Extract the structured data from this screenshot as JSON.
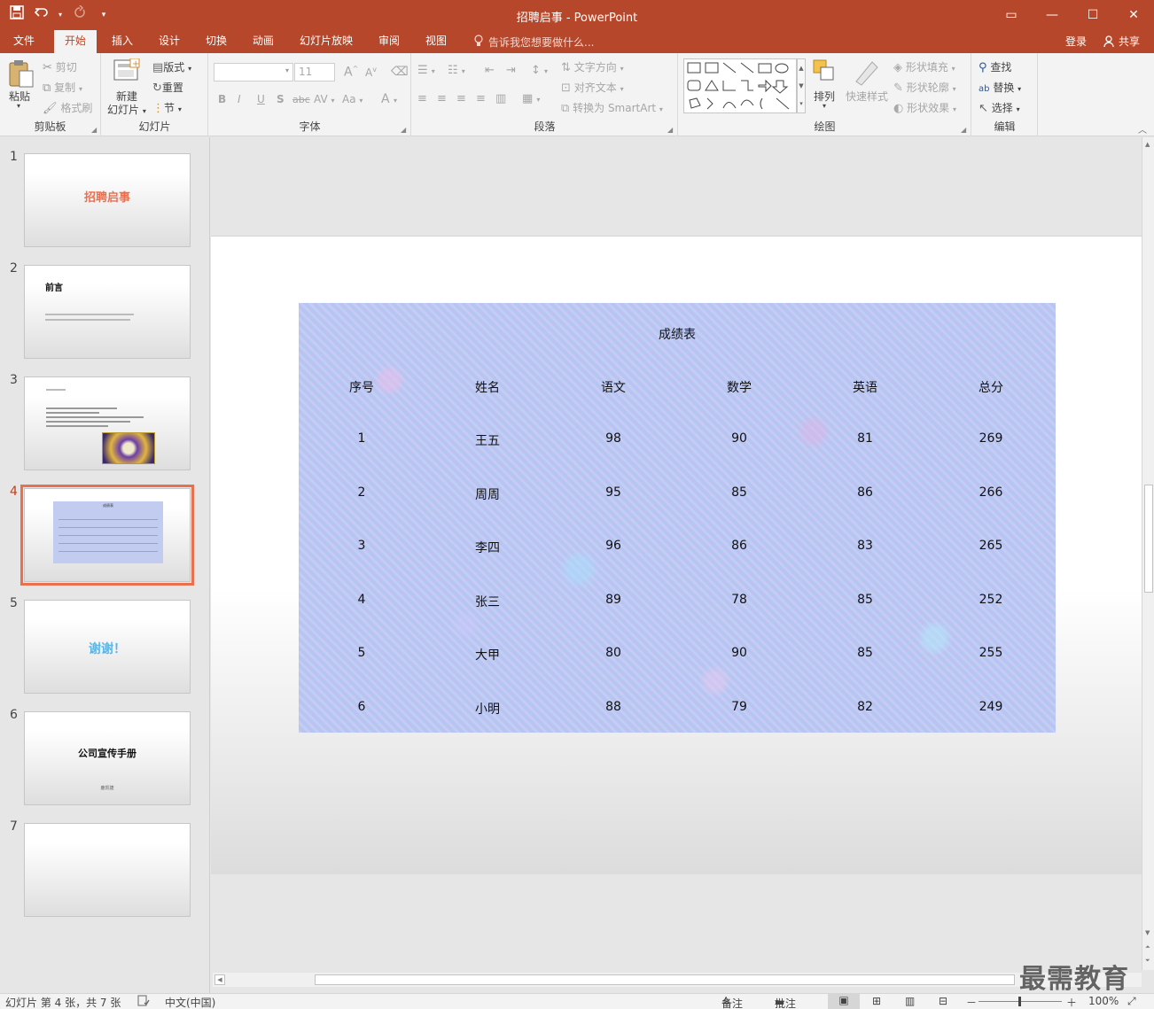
{
  "window": {
    "title": "招聘启事 - PowerPoint",
    "qat": {
      "save_icon": "save-icon",
      "undo_icon": "undo-icon",
      "redo_icon": "redo-icon",
      "customize_icon": "chevron-down-icon"
    },
    "controls": {
      "ribbon_display": "▭",
      "minimize": "—",
      "maximize": "☐",
      "close": "✕"
    }
  },
  "tabs": [
    {
      "label": "文件"
    },
    {
      "label": "开始",
      "active": true
    },
    {
      "label": "插入"
    },
    {
      "label": "设计"
    },
    {
      "label": "切换"
    },
    {
      "label": "动画"
    },
    {
      "label": "幻灯片放映"
    },
    {
      "label": "审阅"
    },
    {
      "label": "视图"
    }
  ],
  "tell_me": "告诉我您想要做什么...",
  "account": {
    "login": "登录",
    "share": "共享"
  },
  "ribbon": {
    "clipboard": {
      "label": "剪贴板",
      "paste": "粘贴",
      "cut": "剪切",
      "copy": "复制",
      "format_painter": "格式刷"
    },
    "slides": {
      "label": "幻灯片",
      "new_slide_line1": "新建",
      "new_slide_line2": "幻灯片",
      "layout": "版式",
      "reset": "重置",
      "section": "节"
    },
    "font": {
      "label": "字体",
      "font_name": "",
      "font_size": "11",
      "bold": "B",
      "italic": "I",
      "underline": "U",
      "shadow": "S",
      "strike": "abc",
      "spacing": "AV",
      "case": "Aa",
      "color": "A"
    },
    "paragraph": {
      "label": "段落",
      "text_direction": "文字方向",
      "align_text": "对齐文本",
      "smartart": "转换为 SmartArt"
    },
    "drawing": {
      "label": "绘图",
      "arrange": "排列",
      "quick_styles": "快速样式",
      "shape_fill": "形状填充",
      "shape_outline": "形状轮廓",
      "shape_effects": "形状效果"
    },
    "editing": {
      "label": "编辑",
      "find": "查找",
      "replace": "替换",
      "select": "选择"
    }
  },
  "thumbnails": [
    {
      "num": "1",
      "title": "招聘启事"
    },
    {
      "num": "2",
      "title": "前言"
    },
    {
      "num": "3",
      "title": ""
    },
    {
      "num": "4",
      "title": "成绩表",
      "active": true
    },
    {
      "num": "5",
      "title": "谢谢！"
    },
    {
      "num": "6",
      "title": "公司宣传手册",
      "subtitle": "鹿凯捷"
    },
    {
      "num": "7",
      "title": ""
    }
  ],
  "slide": {
    "table_title": "成绩表",
    "headers": [
      "序号",
      "姓名",
      "语文",
      "数学",
      "英语",
      "总分"
    ],
    "rows": [
      [
        "1",
        "王五",
        "98",
        "90",
        "81",
        "269"
      ],
      [
        "2",
        "周周",
        "95",
        "85",
        "86",
        "266"
      ],
      [
        "3",
        "李四",
        "96",
        "86",
        "83",
        "265"
      ],
      [
        "4",
        "张三",
        "89",
        "78",
        "85",
        "252"
      ],
      [
        "5",
        "大甲",
        "80",
        "90",
        "85",
        "255"
      ],
      [
        "6",
        "小明",
        "88",
        "79",
        "82",
        "249"
      ]
    ]
  },
  "status": {
    "slide_info": "幻灯片 第 4 张，共 7 张",
    "language": "中文(中国)",
    "notes": "备注",
    "comments": "批注",
    "zoom_minus": "－",
    "zoom_plus": "＋",
    "zoom": "100%"
  },
  "watermark": "最需教育"
}
